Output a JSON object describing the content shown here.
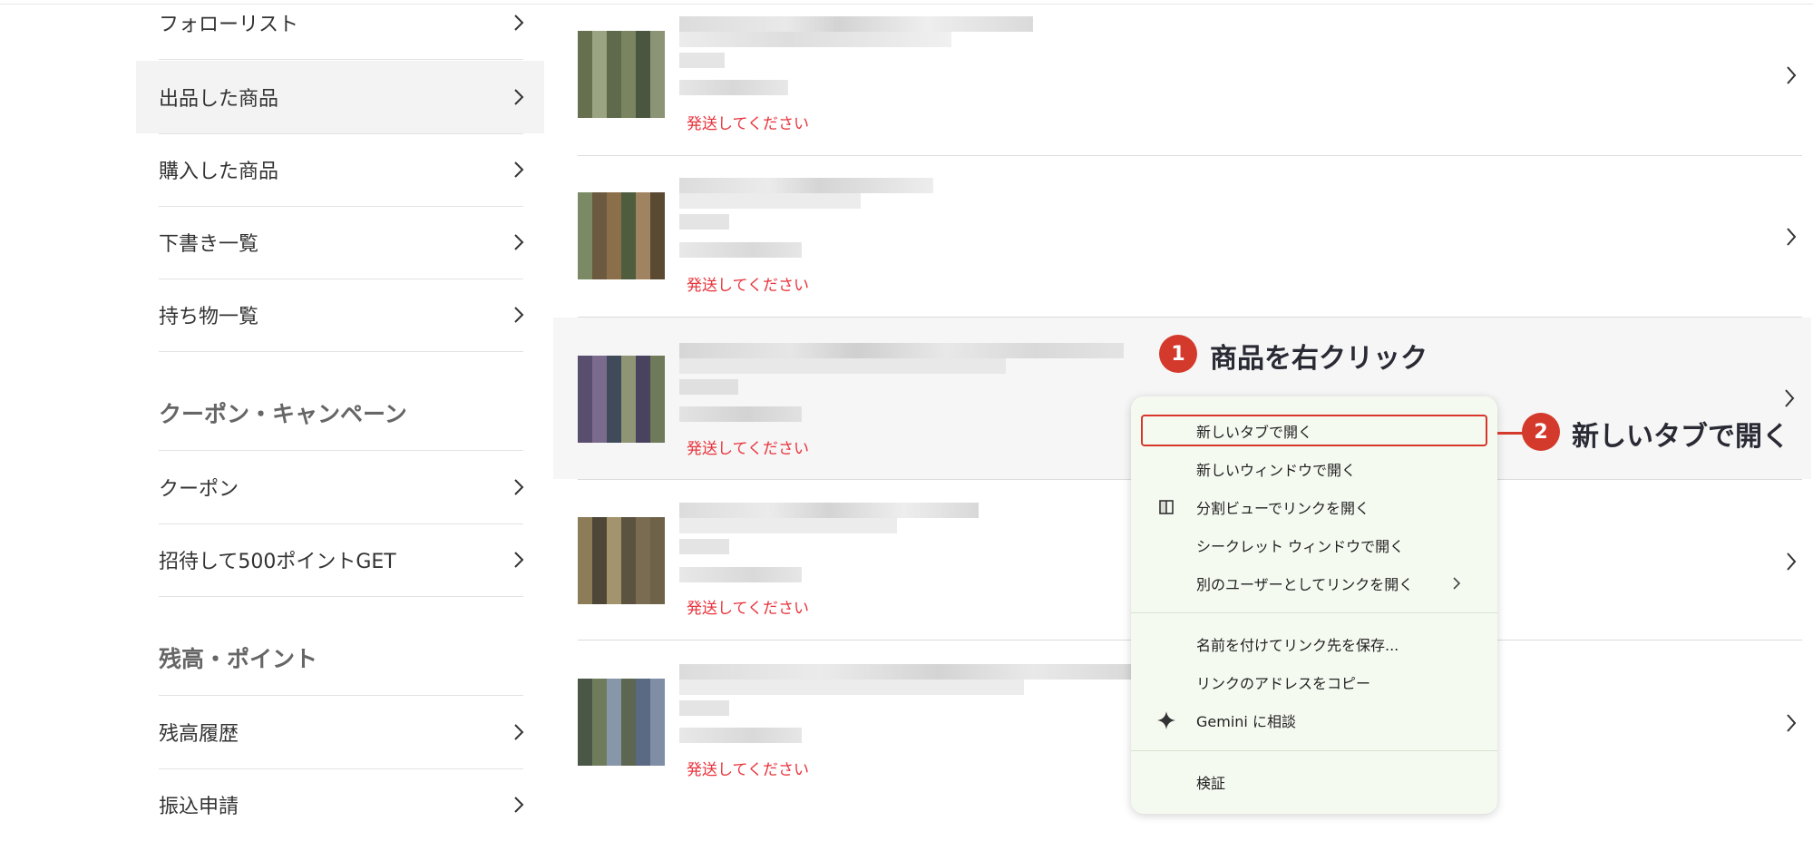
{
  "sidebar": {
    "items": [
      {
        "label": "フォローリスト"
      },
      {
        "label": "出品した商品"
      },
      {
        "label": "購入した商品"
      },
      {
        "label": "下書き一覧"
      },
      {
        "label": "持ち物一覧"
      }
    ],
    "section_coupon": {
      "heading": "クーポン・キャンペーン",
      "items": [
        {
          "label": "クーポン"
        },
        {
          "label": "招待して500ポイントGET"
        }
      ]
    },
    "section_balance": {
      "heading": "残高・ポイント",
      "items": [
        {
          "label": "残高履歴"
        },
        {
          "label": "振込申請"
        }
      ]
    }
  },
  "products": [
    {
      "status": "発送してください"
    },
    {
      "status": "発送してください"
    },
    {
      "status": "発送してください"
    },
    {
      "status": "発送してください"
    },
    {
      "status": "発送してください"
    }
  ],
  "context_menu": {
    "items": [
      {
        "label": "新しいタブで開く",
        "icon": ""
      },
      {
        "label": "新しいウィンドウで開く",
        "icon": ""
      },
      {
        "label": "分割ビューでリンクを開く",
        "icon": "split-view-icon"
      },
      {
        "label": "シークレット ウィンドウで開く",
        "icon": ""
      },
      {
        "label": "別のユーザーとしてリンクを開く",
        "icon": "",
        "submenu": true
      },
      {
        "label": "名前を付けてリンク先を保存...",
        "icon": ""
      },
      {
        "label": "リンクのアドレスをコピー",
        "icon": ""
      },
      {
        "label": "Gemini に相談",
        "icon": "gemini-sparkle-icon"
      },
      {
        "label": "検証",
        "icon": ""
      }
    ]
  },
  "annotations": {
    "step1": {
      "number": "1",
      "text": "商品を右クリック"
    },
    "step2": {
      "number": "2",
      "text": "新しいタブで開く"
    },
    "accent_color": "#d43a2c"
  },
  "colors": {
    "status_red": "#e8343c",
    "menu_bg": "#f5faf1",
    "active_bg": "#f3f3f3"
  }
}
